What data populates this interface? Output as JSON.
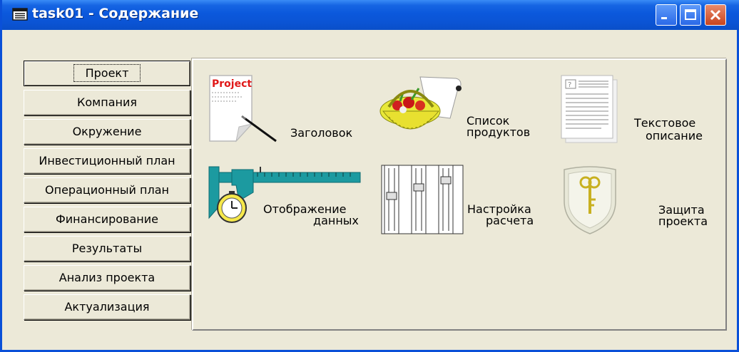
{
  "window": {
    "title": "task01 - Содержание",
    "title_icon": "document-window-icon",
    "controls": [
      "minimize-icon",
      "maximize-icon",
      "close-icon"
    ]
  },
  "menu": {
    "items": [
      {
        "label": "Проект",
        "active": true
      },
      {
        "label": "Компания"
      },
      {
        "label": "Окружение"
      },
      {
        "label": "Инвестиционный план"
      },
      {
        "label": "Операционный план"
      },
      {
        "label": "Финансирование"
      },
      {
        "label": "Результаты"
      },
      {
        "label": "Анализ проекта"
      },
      {
        "label": "Актуализация"
      }
    ]
  },
  "content": {
    "items": [
      {
        "icon": "project-title-icon",
        "icon_text": "Project",
        "label": "Заголовок"
      },
      {
        "icon": "product-basket-icon",
        "label_line1": "Список",
        "label_line2": "продуктов"
      },
      {
        "icon": "text-document-icon",
        "label_line1": "Текстовое",
        "label_line2": "описание"
      },
      {
        "icon": "caliper-stopwatch-icon",
        "label_line1": "Отображение",
        "label_line2": "данных"
      },
      {
        "icon": "slider-settings-icon",
        "label_line1": "Настройка",
        "label_line2": "расчета"
      },
      {
        "icon": "shield-key-icon",
        "label_line1": "Защита",
        "label_line2": "проекта"
      }
    ]
  },
  "colors": {
    "titlebar": "#0b58dc",
    "face": "#ece9d8",
    "close": "#c8441e"
  }
}
